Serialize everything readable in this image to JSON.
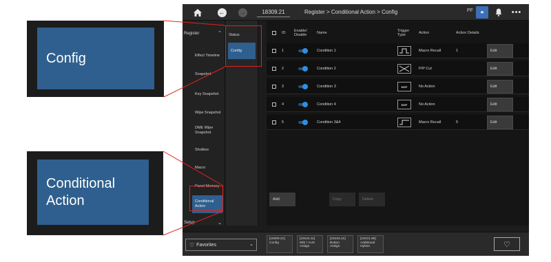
{
  "topbar": {
    "home_icon": "home-icon",
    "id_value": "18309.21",
    "breadcrumb": "Register > Conditional Action > Config",
    "pf_label": "PF"
  },
  "sidebar": {
    "header": "Register",
    "items": [
      {
        "label": "Effect Timeline"
      },
      {
        "label": "Snapshot"
      },
      {
        "label": "Key Snapshot"
      },
      {
        "label": "Wipe Snapshot"
      },
      {
        "label": "DME Wipe Snapshot"
      },
      {
        "label": "Shotbox"
      },
      {
        "label": "Macro"
      },
      {
        "label": "Panel Memory"
      },
      {
        "label": "Conditional Action"
      }
    ],
    "setup": "Setup"
  },
  "subbar": {
    "status": "Status",
    "config": "Config"
  },
  "table": {
    "headers": {
      "id": "ID",
      "enable": "Enable/ Disable",
      "name": "Name",
      "trigger": "Trigger Type",
      "action": "Action",
      "details": "Action Details"
    },
    "rows": [
      {
        "id": "1",
        "name": "Condition 1",
        "trigger": "rising",
        "trigger_text": "",
        "action": "Macro Recall",
        "details": "1",
        "edit": "Edit"
      },
      {
        "id": "2",
        "name": "Condition 2",
        "trigger": "both",
        "trigger_text": "",
        "action": "P/P Cut",
        "details": "",
        "edit": "Edit"
      },
      {
        "id": "3",
        "name": "Condition 3",
        "trigger": "nop",
        "trigger_text": "NOP",
        "action": "No Action",
        "details": "",
        "edit": "Edit"
      },
      {
        "id": "4",
        "name": "Condition 4",
        "trigger": "nop",
        "trigger_text": "NOP",
        "action": "No Action",
        "details": "",
        "edit": "Edit"
      },
      {
        "id": "5",
        "name": "Condition 3&4",
        "trigger": "falling",
        "trigger_text": "",
        "action": "Macro Recall",
        "details": "5",
        "edit": "Edit"
      }
    ],
    "add": "Add",
    "copy": "Copy",
    "delete": "Delete"
  },
  "bottombar": {
    "favorites": "Favorites",
    "items": [
      {
        "line1": "[18309.21]",
        "line2": "Config",
        "line3": ""
      },
      {
        "line1": "[19104.11]",
        "line2": "M/E / AUX",
        "line3": "Assign"
      },
      {
        "line1": "[19104.21]",
        "line2": "Button",
        "line3": "Assign"
      },
      {
        "line1": "[19101.99]",
        "line2": "Additional",
        "line3": "Option"
      }
    ]
  },
  "callouts": {
    "config": "Config",
    "conditional_action_line1": "Conditional",
    "conditional_action_line2": "Action"
  },
  "colors": {
    "accent": "#2f5f8e",
    "highlight": "#e2221b",
    "toggle_on": "#2f8fe0"
  }
}
